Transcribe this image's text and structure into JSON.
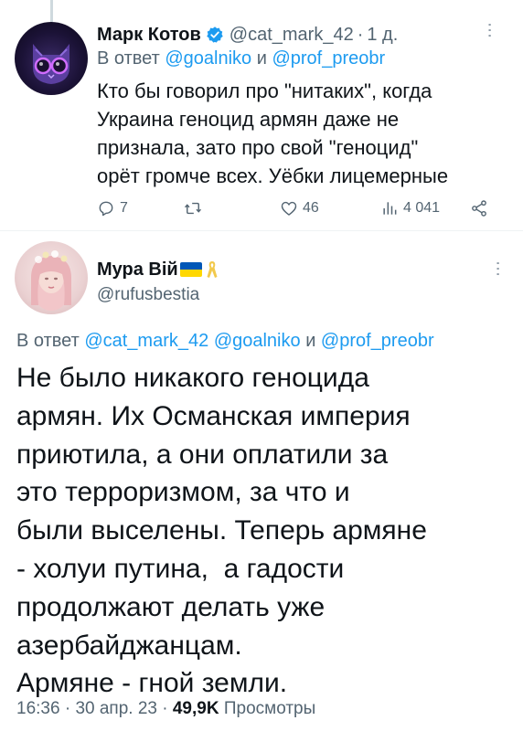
{
  "tweet1": {
    "name": "Марк Котов",
    "handle": "@cat_mark_42",
    "separator": "·",
    "time": "1 д.",
    "reply_prefix": "В ответ",
    "reply_mentions": [
      "@goalniko",
      "@prof_preobr"
    ],
    "reply_conj": "и",
    "body_lines": [
      "Кто бы говорил про \"нитаких\", когда",
      "Украина геноцид армян даже не",
      "признала, зато про свой \"геноцид\"",
      "орёт громче всех. Уёбки лицемерные"
    ],
    "stats": {
      "replies": "7",
      "retweets": "",
      "likes": "46",
      "views": "4 041"
    },
    "icons": [
      "reply-icon",
      "retweet-icon",
      "like-icon",
      "views-icon",
      "share-icon",
      "verified-badge-icon",
      "more-icon"
    ]
  },
  "tweet2": {
    "name": "Мура Вій",
    "handle": "@rufusbestia",
    "reply_prefix": "В ответ",
    "reply_mentions": [
      "@cat_mark_42",
      "@goalniko",
      "@prof_preobr"
    ],
    "reply_conj": "и",
    "body_lines": [
      "Не было никакого геноцида",
      "армян. Их Османская империя",
      "приютила, а они оплатили за",
      "это терроризмом, за что и",
      "были выселены. Теперь армяне",
      "- холуи путина,  а гадости",
      "продолжают делать уже",
      "азербайджанцам.",
      "Армяне - гной земли."
    ],
    "time": "16:36",
    "separator": "·",
    "date": "30 апр. 23",
    "views_count": "49,9K",
    "views_label": "Просмотры",
    "icons": [
      "ukraine-flag-icon",
      "yellow-ribbon-icon",
      "more-icon"
    ]
  },
  "colors": {
    "text": "#0f1419",
    "secondary": "#536471",
    "link": "#1d9bf0",
    "verified": "#1d9bf0"
  }
}
